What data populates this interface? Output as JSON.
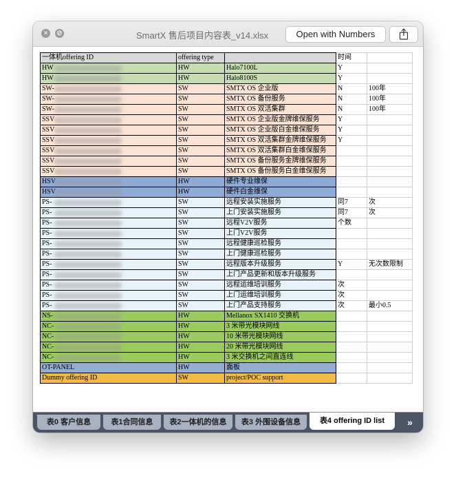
{
  "window": {
    "title": "SmartX 售后项目内容表_v14.xlsx",
    "open_button": "Open with Numbers"
  },
  "sheet": {
    "headers": [
      "一体机offering ID",
      "offering type",
      "",
      "时间",
      ""
    ],
    "rows": [
      {
        "id": "HW",
        "type": "HW",
        "desc": "Halo7100L",
        "t": "Y",
        "e": "",
        "color": "green"
      },
      {
        "id": "HW",
        "type": "HW",
        "desc": "Halo8100S",
        "t": "Y",
        "e": "",
        "color": "green"
      },
      {
        "id": "SW-",
        "type": "SW",
        "desc": "SMTX OS 企业版",
        "t": "N",
        "e": "100年",
        "color": "peach"
      },
      {
        "id": "SW-",
        "type": "SW",
        "desc": "SMTX OS 备份服务",
        "t": "N",
        "e": "100年",
        "color": "peach"
      },
      {
        "id": "SW-",
        "type": "SW",
        "desc": "SMTX OS 双活集群",
        "t": "N",
        "e": "100年",
        "color": "peach"
      },
      {
        "id": "SSV",
        "type": "SW",
        "desc": "SMTX OS 企业版金牌维保服务",
        "t": "Y",
        "e": "",
        "color": "peach"
      },
      {
        "id": "SSV",
        "type": "SW",
        "desc": "SMTX OS 企业版白金维保服务",
        "t": "Y",
        "e": "",
        "color": "peach"
      },
      {
        "id": "SSV",
        "type": "SW",
        "desc": "SMTX OS 双活集群金牌维保服务",
        "t": "Y",
        "e": "",
        "color": "peach"
      },
      {
        "id": "SSV",
        "type": "SW",
        "desc": "SMTX OS 双活集群白金维保服务",
        "t": "",
        "e": "",
        "color": "peach"
      },
      {
        "id": "SSV",
        "type": "SW",
        "desc": "SMTX OS 备份服务金牌维保服务",
        "t": "",
        "e": "",
        "color": "peach"
      },
      {
        "id": "SSV",
        "type": "SW",
        "desc": "SMTX OS 备份服务白金维保服务",
        "t": "",
        "e": "",
        "color": "peach"
      },
      {
        "id": "HSV",
        "type": "HW",
        "desc": "硬件专业维保",
        "t": "",
        "e": "",
        "color": "blue"
      },
      {
        "id": "HSV",
        "type": "HW",
        "desc": "硬件白金维保",
        "t": "",
        "e": "",
        "color": "blue"
      },
      {
        "id": "PS-",
        "type": "SW",
        "desc": "远程安装实施服务",
        "t": "同7",
        "e": "次",
        "color": "light"
      },
      {
        "id": "PS-",
        "type": "SW",
        "desc": "上门安装实施服务",
        "t": "同7",
        "e": "次",
        "color": "light"
      },
      {
        "id": "PS-",
        "type": "SW",
        "desc": "远程V2V服务",
        "t": "个数",
        "e": "",
        "color": "light"
      },
      {
        "id": "PS-",
        "type": "SW",
        "desc": "上门V2V服务",
        "t": "",
        "e": "",
        "color": "light"
      },
      {
        "id": "PS-",
        "type": "SW",
        "desc": "远程健康巡检服务",
        "t": "",
        "e": "",
        "color": "light"
      },
      {
        "id": "PS-",
        "type": "SW",
        "desc": "上门健康巡检服务",
        "t": "",
        "e": "",
        "color": "light"
      },
      {
        "id": "PS-",
        "type": "SW",
        "desc": "远程版本升级服务",
        "t": "Y",
        "e": "无次数限制",
        "color": "light"
      },
      {
        "id": "PS-",
        "type": "SW",
        "desc": "上门产品更新和版本升级服务",
        "t": "",
        "e": "",
        "color": "light"
      },
      {
        "id": "PS-",
        "type": "SW",
        "desc": "远程运维培训服务",
        "t": "次",
        "e": "",
        "color": "light"
      },
      {
        "id": "PS-",
        "type": "SW",
        "desc": "上门运维培训服务",
        "t": "次",
        "e": "",
        "color": "light"
      },
      {
        "id": "PS-",
        "type": "SW",
        "desc": "上门产品支持服务",
        "t": "次",
        "e": "最小0.5",
        "color": "light"
      },
      {
        "id": "NS-",
        "type": "HW",
        "desc": "Mellanox SX1410 交换机",
        "t": "",
        "e": "",
        "color": "brgreen"
      },
      {
        "id": "NC-",
        "type": "HW",
        "desc": "3 米带光模块网线",
        "t": "",
        "e": "",
        "color": "brgreen"
      },
      {
        "id": "NC-",
        "type": "HW",
        "desc": "10 米带光模块网线",
        "t": "",
        "e": "",
        "color": "brgreen"
      },
      {
        "id": "NC-",
        "type": "HW",
        "desc": "20 米带光模块网线",
        "t": "",
        "e": "",
        "color": "brgreen"
      },
      {
        "id": "NC-",
        "type": "HW",
        "desc": "3 米交换机之间直连线",
        "t": "",
        "e": "",
        "color": "brgreen"
      },
      {
        "id": "OT-PANEL",
        "type": "HW",
        "desc": "面板",
        "t": "",
        "e": "",
        "color": "steel"
      },
      {
        "id": "Dummy offering ID",
        "type": "SW",
        "desc": "project/POC support",
        "t": "",
        "e": "",
        "color": "orange"
      }
    ]
  },
  "tabs": [
    {
      "label": "表0 客户信息",
      "active": false
    },
    {
      "label": "表1合同信息",
      "active": false
    },
    {
      "label": "表2一体机的信息",
      "active": false
    },
    {
      "label": "表3 外围设备信息",
      "active": false
    },
    {
      "label": "表4 offering ID list",
      "active": true
    }
  ],
  "colors": {
    "hdr": "#d8d8d8",
    "green": "#c6dcb1",
    "peach": "#fbe3d3",
    "blue": "#8eaad7",
    "light": "#e8f3f9",
    "brgreen": "#9bcb5e",
    "steel": "#95acd6",
    "orange": "#f2b943"
  },
  "icons": {
    "close": "close-icon",
    "minimize": "minimize-icon",
    "share": "share-icon",
    "more": "chevron-right-double-icon"
  }
}
